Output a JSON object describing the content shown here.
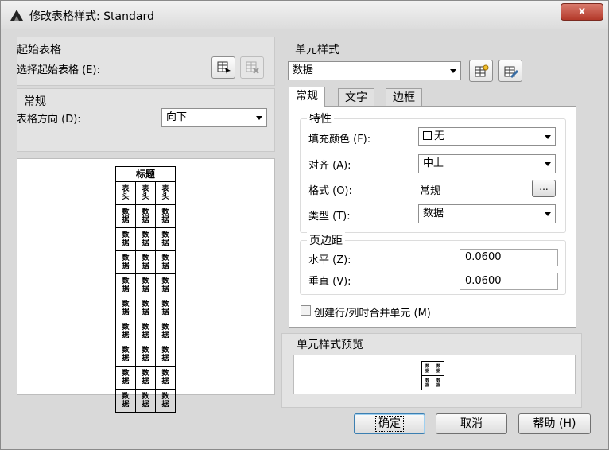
{
  "window": {
    "title": "修改表格样式: Standard",
    "close_label": "x"
  },
  "start_table": {
    "title": "起始表格",
    "select_label": "选择起始表格 (E):"
  },
  "general": {
    "title": "常规",
    "direction_label": "表格方向 (D):",
    "direction_value": "向下"
  },
  "table_preview": {
    "title": "标题",
    "header_cell": "表头",
    "data_cell": "数据",
    "data_rows": 9,
    "columns": 3
  },
  "cell_styles": {
    "title": "单元样式",
    "selected": "数据"
  },
  "tabs": [
    {
      "label": "常规",
      "active": true
    },
    {
      "label": "文字",
      "active": false
    },
    {
      "label": "边框",
      "active": false
    }
  ],
  "properties": {
    "title": "特性",
    "fill_color_label": "填充颜色 (F):",
    "fill_color_value": "无",
    "align_label": "对齐 (A):",
    "align_value": "中上",
    "format_label": "格式 (O):",
    "format_value": "常规",
    "format_button": "...",
    "type_label": "类型 (T):",
    "type_value": "数据"
  },
  "margins": {
    "title": "页边距",
    "horizontal_label": "水平 (Z):",
    "horizontal_value": "0.0600",
    "vertical_label": "垂直 (V):",
    "vertical_value": "0.0600"
  },
  "merge_checkbox": {
    "label": "创建行/列时合并单元 (M)",
    "checked": false
  },
  "cell_style_preview": {
    "title": "单元样式预览",
    "cell_text": "数据"
  },
  "buttons": {
    "ok": "确定",
    "cancel": "取消",
    "help": "帮助 (H)"
  }
}
